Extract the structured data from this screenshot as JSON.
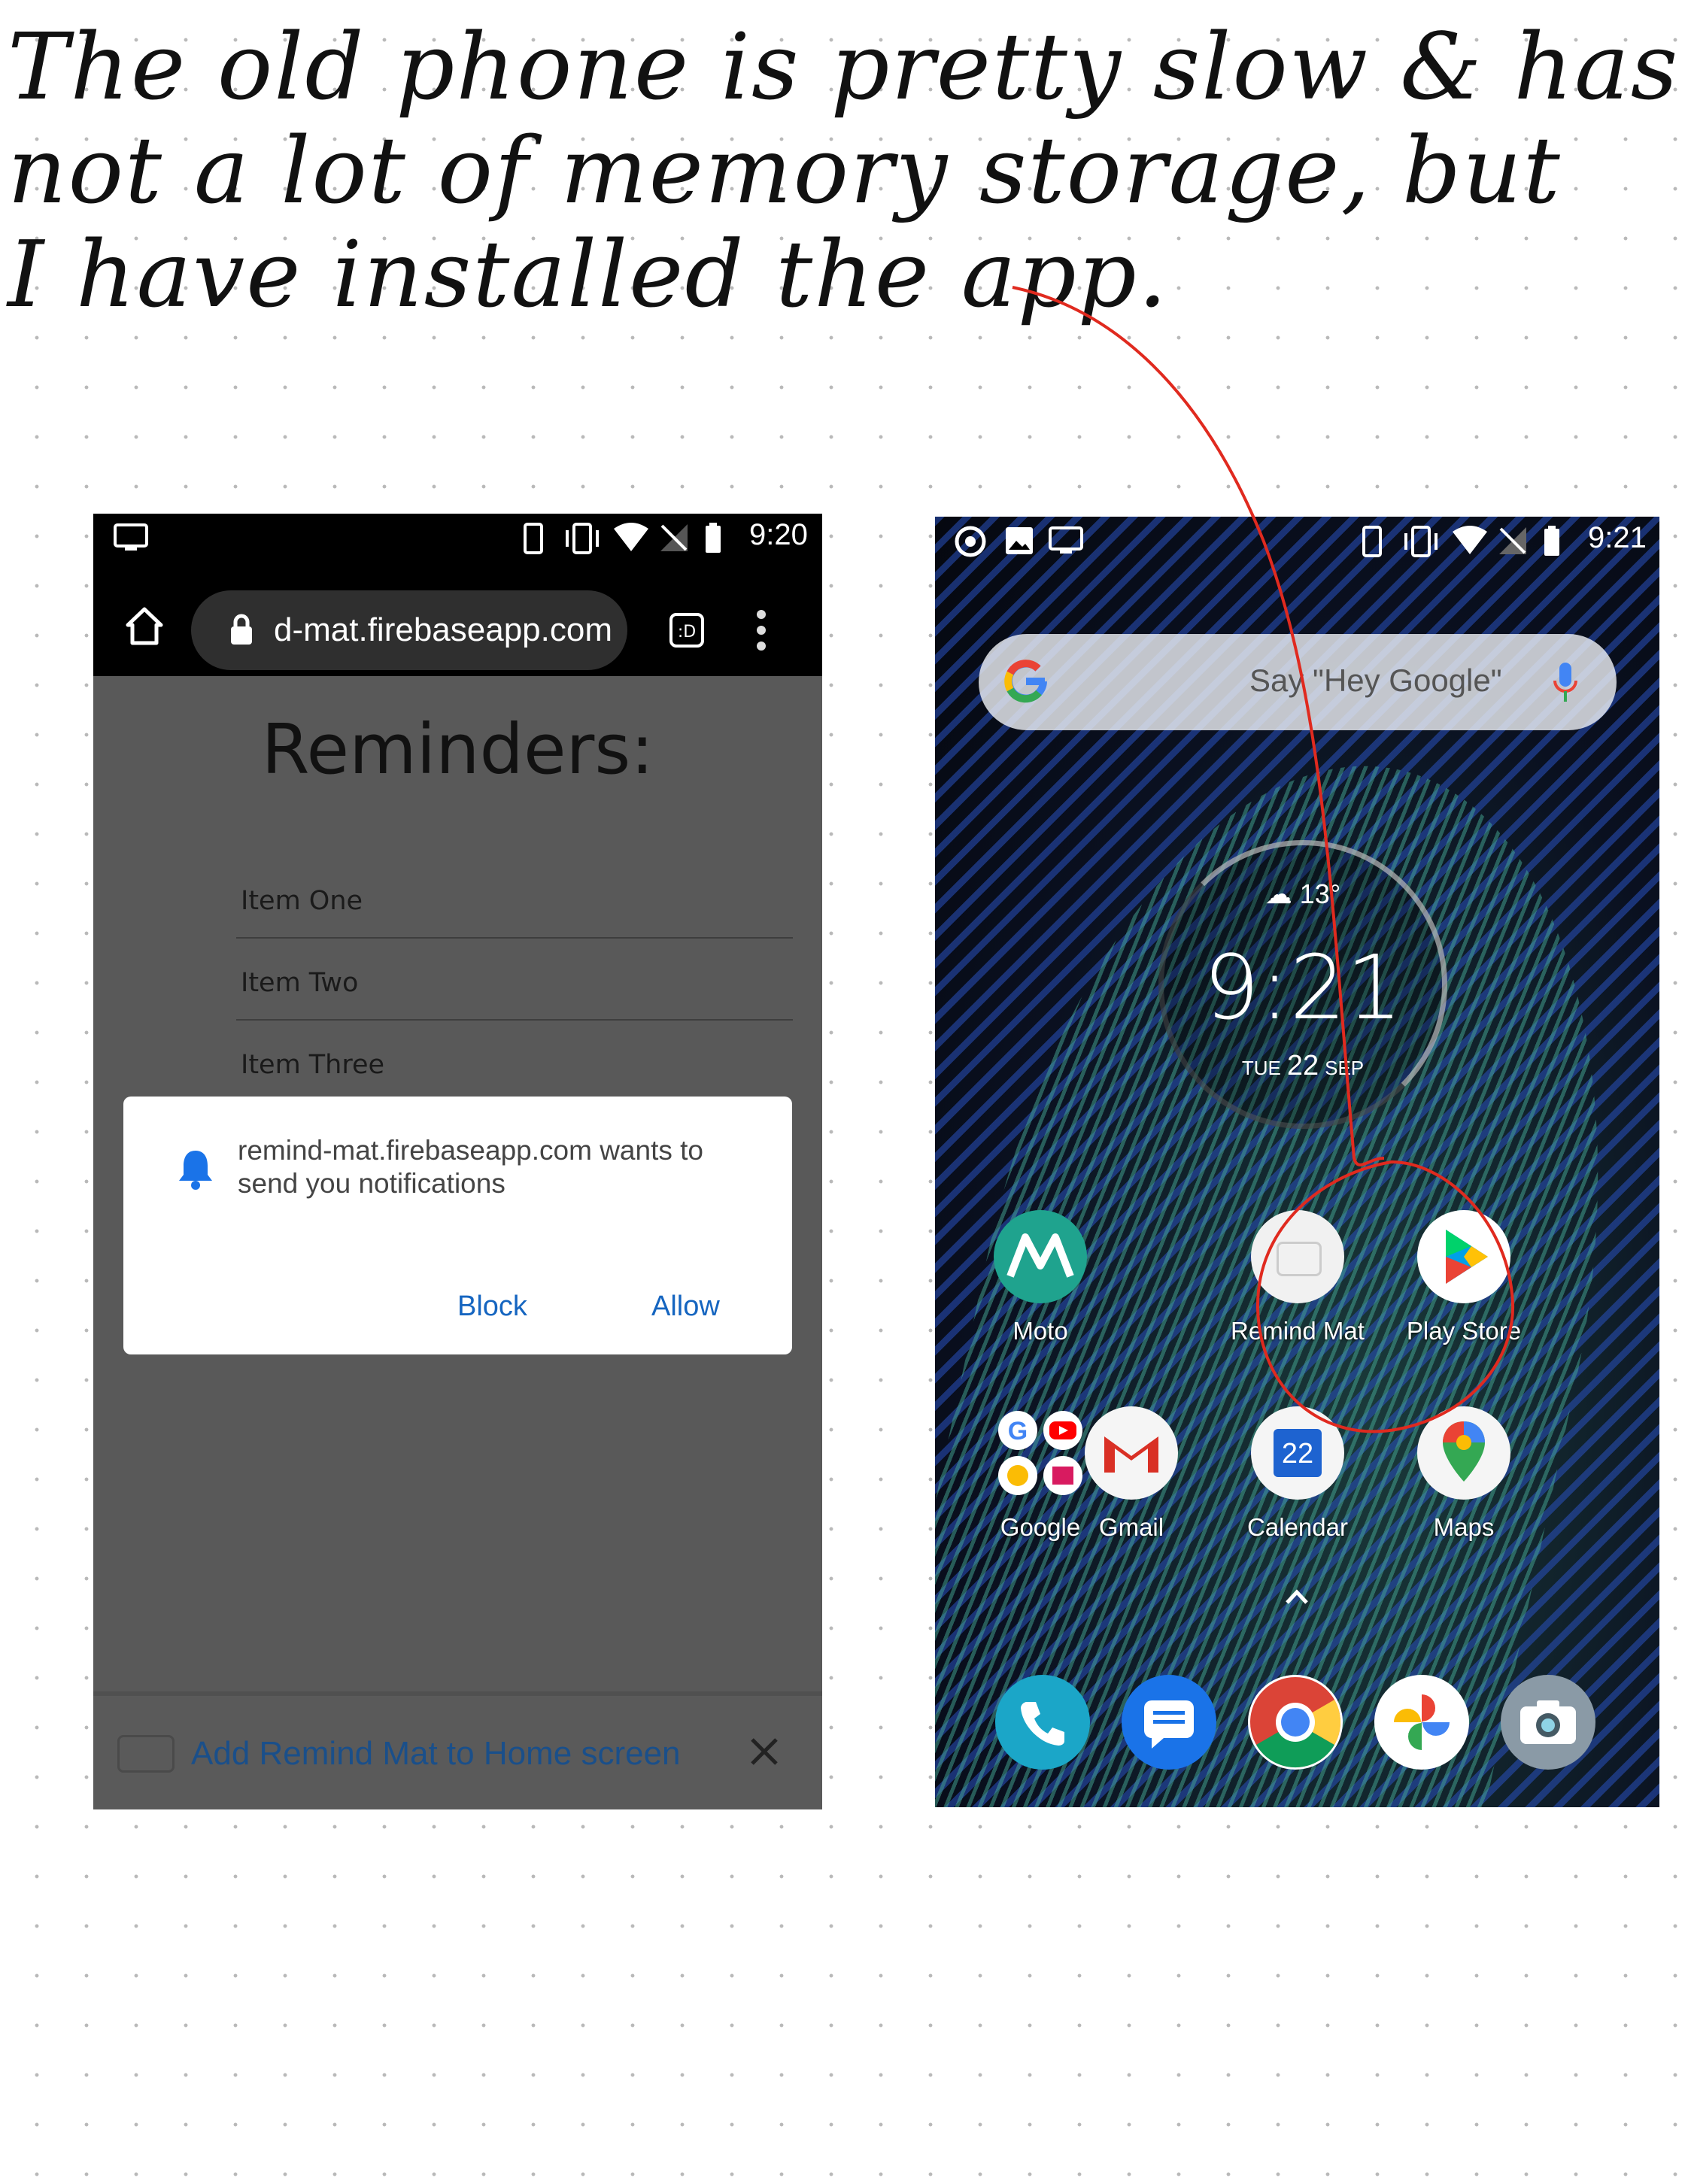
{
  "note": {
    "lines": [
      "The old phone is pretty slow & has",
      "not a lot of memory storage, but",
      "I have installed the app."
    ]
  },
  "left_phone": {
    "status_time": "9:20",
    "url": "d-mat.firebaseapp.com",
    "page_title": "Reminders:",
    "items": [
      "Item One",
      "Item Two",
      "Item Three"
    ],
    "dialog": {
      "message": "remind-mat.firebaseapp.com wants to send you notifications",
      "block": "Block",
      "allow": "Allow"
    },
    "a2hs_text": "Add Remind Mat to Home screen"
  },
  "right_phone": {
    "status_time": "9:21",
    "search_hint": "Say \"Hey Google\"",
    "clock": {
      "temp": "13°",
      "time": "9:21",
      "day": "TUE",
      "date": "22",
      "month": "SEP"
    },
    "apps": {
      "moto": "Moto",
      "remind_mat": "Remind Mat",
      "play_store": "Play Store",
      "google": "Google",
      "gmail": "Gmail",
      "calendar": "Calendar",
      "calendar_day": "22",
      "maps": "Maps"
    }
  },
  "colors": {
    "annotation_red": "#e02a1f",
    "link_blue": "#1565c0"
  }
}
